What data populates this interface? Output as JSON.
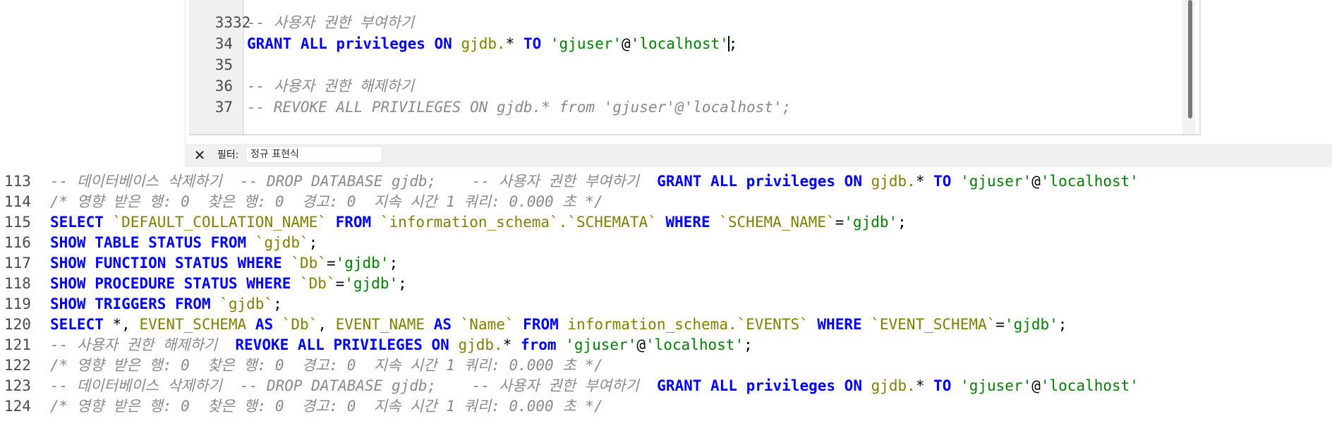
{
  "editor": {
    "partial_line_number": "32",
    "lines": [
      {
        "num": "33",
        "tokens": [
          {
            "t": "-- 사용자 권한 부여하기",
            "c": "c"
          }
        ]
      },
      {
        "num": "34",
        "tokens": [
          {
            "t": "GRANT ALL privileges ON ",
            "c": "k"
          },
          {
            "t": "gjdb.",
            "c": "o"
          },
          {
            "t": "* ",
            "c": "p"
          },
          {
            "t": "TO ",
            "c": "k"
          },
          {
            "t": "'gjuser'",
            "c": "s"
          },
          {
            "t": "@",
            "c": "p"
          },
          {
            "t": "'localhost'",
            "c": "s"
          },
          {
            "t": "|",
            "c": "cursor"
          },
          {
            "t": ";",
            "c": "p"
          }
        ]
      },
      {
        "num": "35",
        "tokens": []
      },
      {
        "num": "36",
        "tokens": [
          {
            "t": "-- 사용자 권한 해제하기",
            "c": "c"
          }
        ]
      },
      {
        "num": "37",
        "tokens": [
          {
            "t": "-- REVOKE ALL PRIVILEGES ON gjdb.* from 'gjuser'@'localhost';",
            "c": "c"
          }
        ]
      }
    ]
  },
  "filter": {
    "close_label": "✕",
    "label": "필터:",
    "placeholder": "정규 표현식",
    "value": ""
  },
  "log": {
    "lines": [
      {
        "num": "113",
        "tokens": [
          {
            "t": "-- 데이터베이스 삭제하기  -- DROP DATABASE gjdb;    -- 사용자 권한 부여하기  ",
            "c": "c"
          },
          {
            "t": "GRANT ALL privileges ON ",
            "c": "k"
          },
          {
            "t": "gjdb.",
            "c": "o"
          },
          {
            "t": "* ",
            "c": "p"
          },
          {
            "t": "TO ",
            "c": "k"
          },
          {
            "t": "'gjuser'",
            "c": "s"
          },
          {
            "t": "@",
            "c": "p"
          },
          {
            "t": "'localhost'",
            "c": "s"
          }
        ]
      },
      {
        "num": "114",
        "tokens": [
          {
            "t": "/* 영향 받은 행: 0  찾은 행: 0  경고: 0  지속 시간 1 쿼리: 0.000 초 */",
            "c": "c"
          }
        ]
      },
      {
        "num": "115",
        "tokens": [
          {
            "t": "SELECT ",
            "c": "k"
          },
          {
            "t": "`DEFAULT_COLLATION_NAME` ",
            "c": "o"
          },
          {
            "t": "FROM ",
            "c": "k"
          },
          {
            "t": "`information_schema`.`SCHEMATA` ",
            "c": "o"
          },
          {
            "t": "WHERE ",
            "c": "k"
          },
          {
            "t": "`SCHEMA_NAME`",
            "c": "o"
          },
          {
            "t": "=",
            "c": "p"
          },
          {
            "t": "'gjdb'",
            "c": "s"
          },
          {
            "t": ";",
            "c": "p"
          }
        ]
      },
      {
        "num": "116",
        "tokens": [
          {
            "t": "SHOW TABLE STATUS FROM ",
            "c": "k"
          },
          {
            "t": "`gjdb`",
            "c": "o"
          },
          {
            "t": ";",
            "c": "p"
          }
        ]
      },
      {
        "num": "117",
        "tokens": [
          {
            "t": "SHOW FUNCTION STATUS WHERE ",
            "c": "k"
          },
          {
            "t": "`Db`",
            "c": "o"
          },
          {
            "t": "=",
            "c": "p"
          },
          {
            "t": "'gjdb'",
            "c": "s"
          },
          {
            "t": ";",
            "c": "p"
          }
        ]
      },
      {
        "num": "118",
        "tokens": [
          {
            "t": "SHOW PROCEDURE STATUS WHERE ",
            "c": "k"
          },
          {
            "t": "`Db`",
            "c": "o"
          },
          {
            "t": "=",
            "c": "p"
          },
          {
            "t": "'gjdb'",
            "c": "s"
          },
          {
            "t": ";",
            "c": "p"
          }
        ]
      },
      {
        "num": "119",
        "tokens": [
          {
            "t": "SHOW TRIGGERS FROM ",
            "c": "k"
          },
          {
            "t": "`gjdb`",
            "c": "o"
          },
          {
            "t": ";",
            "c": "p"
          }
        ]
      },
      {
        "num": "120",
        "tokens": [
          {
            "t": "SELECT ",
            "c": "k"
          },
          {
            "t": "*, ",
            "c": "p"
          },
          {
            "t": "EVENT_SCHEMA ",
            "c": "o"
          },
          {
            "t": "AS ",
            "c": "k"
          },
          {
            "t": "`Db`",
            "c": "o"
          },
          {
            "t": ", ",
            "c": "p"
          },
          {
            "t": "EVENT_NAME ",
            "c": "o"
          },
          {
            "t": "AS ",
            "c": "k"
          },
          {
            "t": "`Name` ",
            "c": "o"
          },
          {
            "t": "FROM ",
            "c": "k"
          },
          {
            "t": "information_schema.`EVENTS` ",
            "c": "o"
          },
          {
            "t": "WHERE ",
            "c": "k"
          },
          {
            "t": "`EVENT_SCHEMA`",
            "c": "o"
          },
          {
            "t": "=",
            "c": "p"
          },
          {
            "t": "'gjdb'",
            "c": "s"
          },
          {
            "t": ";",
            "c": "p"
          }
        ]
      },
      {
        "num": "121",
        "tokens": [
          {
            "t": "-- 사용자 권한 해제하기  ",
            "c": "c"
          },
          {
            "t": "REVOKE ALL PRIVILEGES ON ",
            "c": "k"
          },
          {
            "t": "gjdb.",
            "c": "o"
          },
          {
            "t": "* ",
            "c": "p"
          },
          {
            "t": "from ",
            "c": "k"
          },
          {
            "t": "'gjuser'",
            "c": "s"
          },
          {
            "t": "@",
            "c": "p"
          },
          {
            "t": "'localhost'",
            "c": "s"
          },
          {
            "t": ";",
            "c": "p"
          }
        ]
      },
      {
        "num": "122",
        "tokens": [
          {
            "t": "/* 영향 받은 행: 0  찾은 행: 0  경고: 0  지속 시간 1 쿼리: 0.000 초 */",
            "c": "c"
          }
        ]
      },
      {
        "num": "123",
        "tokens": [
          {
            "t": "-- 데이터베이스 삭제하기  -- DROP DATABASE gjdb;    -- 사용자 권한 부여하기  ",
            "c": "c"
          },
          {
            "t": "GRANT ALL privileges ON ",
            "c": "k"
          },
          {
            "t": "gjdb.",
            "c": "o"
          },
          {
            "t": "* ",
            "c": "p"
          },
          {
            "t": "TO ",
            "c": "k"
          },
          {
            "t": "'gjuser'",
            "c": "s"
          },
          {
            "t": "@",
            "c": "p"
          },
          {
            "t": "'localhost'",
            "c": "s"
          }
        ]
      },
      {
        "num": "124",
        "tokens": [
          {
            "t": "/* 영향 받은 행: 0  찾은 행: 0  경고: 0  지속 시간 1 쿼리: 0.000 초 */",
            "c": "c"
          }
        ]
      }
    ]
  },
  "colors": {
    "keyword": "#0000ff",
    "comment": "#8a8a8a",
    "string": "#008000",
    "identifier": "#808000",
    "line_number": "#4a4a4a",
    "gutter_bg": "#f0f0f0"
  }
}
